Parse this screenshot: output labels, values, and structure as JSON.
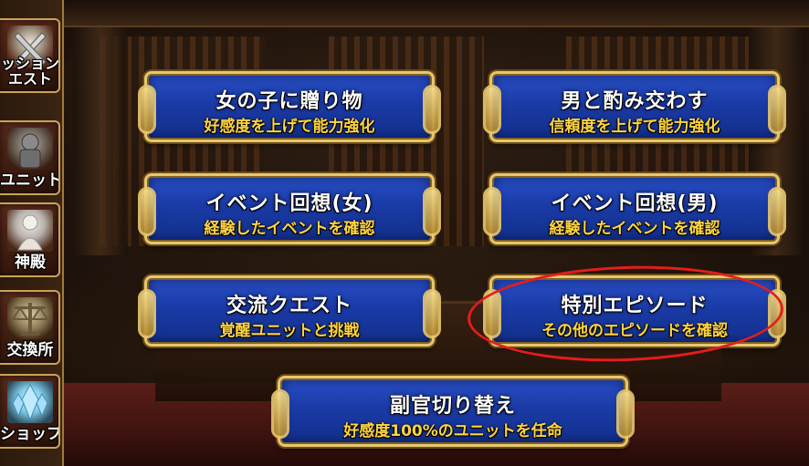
{
  "sidebar": {
    "items": [
      {
        "label_line1": "ッション",
        "label_line2": "エスト",
        "icon": "sword-icon"
      },
      {
        "label_line1": "ユニット",
        "label_line2": "",
        "icon": "knight-icon"
      },
      {
        "label_line1": "神殿",
        "label_line2": "",
        "icon": "goddess-icon"
      },
      {
        "label_line1": "交換所",
        "label_line2": "",
        "icon": "scales-icon"
      },
      {
        "label_line1": "ショップ",
        "label_line2": "",
        "icon": "crystal-icon"
      }
    ]
  },
  "menu": {
    "gift_girl": {
      "title": "女の子に贈り物",
      "subtitle": "好感度を上げて能力強化"
    },
    "drink_men": {
      "title": "男と酌み交わす",
      "subtitle": "信頼度を上げて能力強化"
    },
    "event_recall_female": {
      "title": "イベント回想(女)",
      "subtitle": "経験したイベントを確認"
    },
    "event_recall_male": {
      "title": "イベント回想(男)",
      "subtitle": "経験したイベントを確認"
    },
    "exchange_quest": {
      "title": "交流クエスト",
      "subtitle": "覚醒ユニットと挑戦"
    },
    "special_episode": {
      "title": "特別エピソード",
      "subtitle": "その他のエピソードを確認"
    },
    "switch_adjutant": {
      "title": "副官切り替え",
      "subtitle": "好感度100%のユニットを任命"
    }
  },
  "colors": {
    "button_blue": "#1a3aa6",
    "button_gold_border": "#e7c76e",
    "subtitle_yellow": "#ffd440",
    "highlight_red": "#e61c1c"
  }
}
